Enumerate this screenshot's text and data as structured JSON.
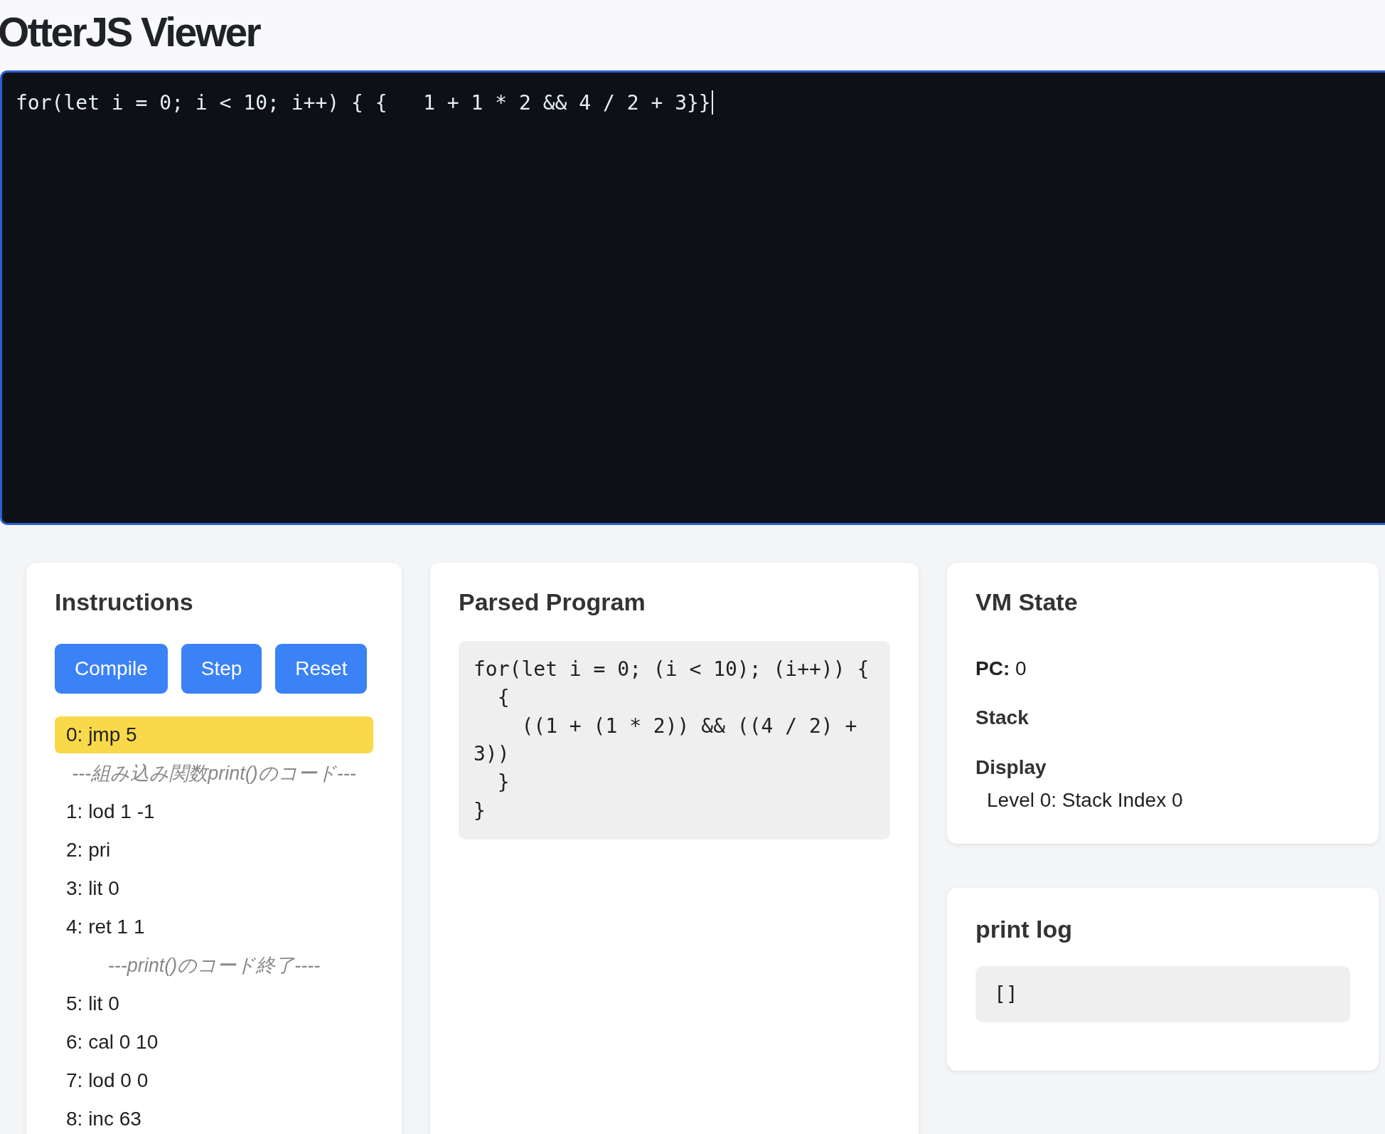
{
  "page_title": "OtterJS Viewer",
  "editor": {
    "value": "for(let i = 0; i < 10; i++) { {   1 + 1 * 2 && 4 / 2 + 3}}",
    "focused": true
  },
  "instructions": {
    "title": "Instructions",
    "buttons": [
      "Compile",
      "Step",
      "Reset"
    ],
    "items": [
      {
        "kind": "instruction",
        "text": "0: jmp 5",
        "current": true
      },
      {
        "kind": "comment",
        "text": "---組み込み関数print()のコード---",
        "current": false
      },
      {
        "kind": "instruction",
        "text": "1: lod 1 -1",
        "current": false
      },
      {
        "kind": "instruction",
        "text": "2: pri",
        "current": false
      },
      {
        "kind": "instruction",
        "text": "3: lit 0",
        "current": false
      },
      {
        "kind": "instruction",
        "text": "4: ret 1 1",
        "current": false
      },
      {
        "kind": "comment",
        "text": "---print()のコード終了----",
        "current": false
      },
      {
        "kind": "instruction",
        "text": "5: lit 0",
        "current": false
      },
      {
        "kind": "instruction",
        "text": "6: cal 0 10",
        "current": false
      },
      {
        "kind": "instruction",
        "text": "7: lod 0 0",
        "current": false
      },
      {
        "kind": "instruction",
        "text": "8: inc 63",
        "current": false
      }
    ]
  },
  "parsed_program": {
    "title": "Parsed Program",
    "code": "for(let i = 0; (i < 10); (i++)) {\n  {\n    ((1 + (1 * 2)) && ((4 / 2) + 3))\n  }\n}"
  },
  "vm_state": {
    "title": "VM State",
    "pc": "**PC:** 0",
    "stack": {
      "title": "Stack"
    },
    "display": {
      "title": "Display",
      "entries": [
        "Level 0: Stack Index 0"
      ]
    }
  },
  "print_log": {
    "title": "print log",
    "output": "[]"
  }
}
